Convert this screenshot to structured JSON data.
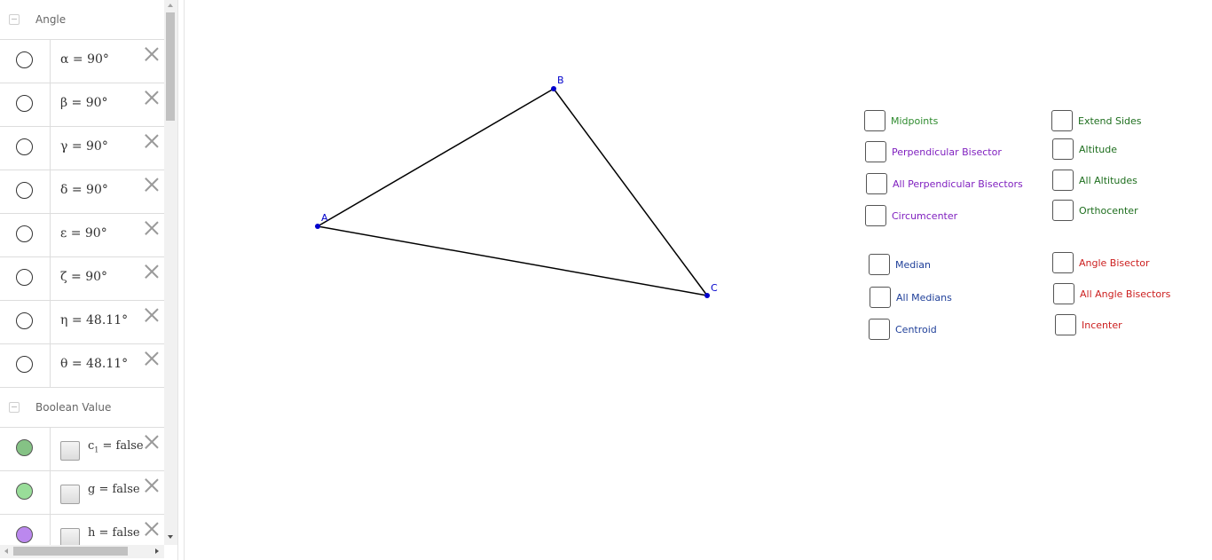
{
  "algebra": {
    "groups": [
      {
        "label": "Angle",
        "rows": [
          {
            "formula": "α = 90°",
            "marble_color": "#ffffff"
          },
          {
            "formula": "β = 90°",
            "marble_color": "#ffffff"
          },
          {
            "formula": "γ = 90°",
            "marble_color": "#ffffff"
          },
          {
            "formula": "δ = 90°",
            "marble_color": "#ffffff"
          },
          {
            "formula": "ε = 90°",
            "marble_color": "#ffffff"
          },
          {
            "formula": "ζ = 90°",
            "marble_color": "#ffffff"
          },
          {
            "formula": "η = 48.11°",
            "marble_color": "#ffffff"
          },
          {
            "formula": "θ = 48.11°",
            "marble_color": "#ffffff"
          }
        ]
      },
      {
        "label": "Boolean Value",
        "rows": [
          {
            "name": "c",
            "subscript": "1",
            "rest": " = false",
            "marble_color": "#85c285"
          },
          {
            "name": "g",
            "subscript": "",
            "rest": " = false",
            "marble_color": "#99dd99"
          },
          {
            "name": "h",
            "subscript": "",
            "rest": " = false",
            "marble_color": "#bb88ee"
          }
        ]
      }
    ]
  },
  "graphics": {
    "points": [
      {
        "label": "A"
      },
      {
        "label": "B"
      },
      {
        "label": "C"
      }
    ],
    "point_color": "#0000cc",
    "segment_color": "#000000",
    "checkboxes": [
      {
        "label": "Midpoints",
        "color": "#2e8b2e"
      },
      {
        "label": "Perpendicular Bisector",
        "color": "#7f1fbf"
      },
      {
        "label": "All Perpendicular Bisectors",
        "color": "#7f1fbf"
      },
      {
        "label": "Circumcenter",
        "color": "#7f1fbf"
      },
      {
        "label": "Median",
        "color": "#1f3f99"
      },
      {
        "label": "All Medians",
        "color": "#1f3f99"
      },
      {
        "label": "Centroid",
        "color": "#1f3f99"
      },
      {
        "label": "Extend Sides",
        "color": "#1e6e1e"
      },
      {
        "label": "Altitude",
        "color": "#1e6e1e"
      },
      {
        "label": "All Altitudes",
        "color": "#1e6e1e"
      },
      {
        "label": "Orthocenter",
        "color": "#1e6e1e"
      },
      {
        "label": "Angle Bisector",
        "color": "#cc1f1f"
      },
      {
        "label": "All Angle Bisectors",
        "color": "#cc1f1f"
      },
      {
        "label": "Incenter",
        "color": "#cc1f1f"
      }
    ]
  }
}
